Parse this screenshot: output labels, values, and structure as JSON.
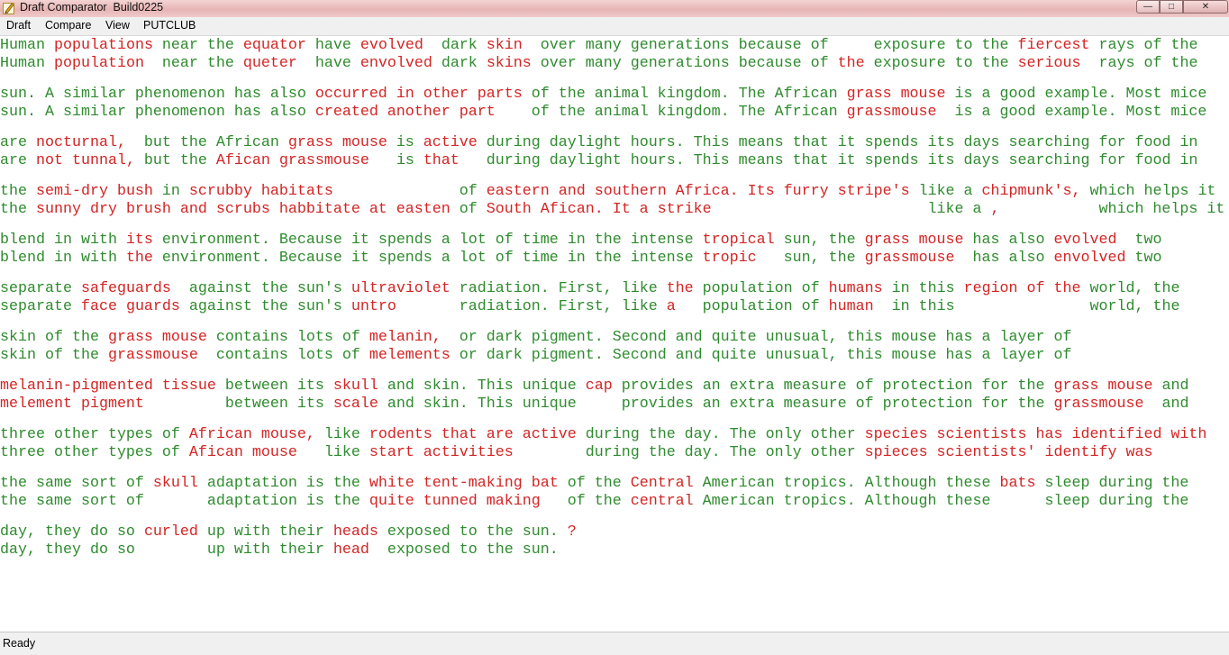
{
  "window": {
    "title": "Draft Comparator  Build0225",
    "minimize_glyph": "—",
    "maximize_glyph": "□",
    "close_glyph": "✕"
  },
  "menu": [
    "Draft",
    "Compare",
    "View",
    "PUTCLUB"
  ],
  "colors": {
    "match": "#2e8b2e",
    "mismatch": "#d42424"
  },
  "status": {
    "text": "Ready"
  },
  "comparison_pairs": [
    {
      "original": [
        [
          "g",
          "Human "
        ],
        [
          "r",
          "populations"
        ],
        [
          "g",
          " near the "
        ],
        [
          "r",
          "equator"
        ],
        [
          "g",
          " have "
        ],
        [
          "r",
          "evolved"
        ],
        [
          "g",
          "  dark "
        ],
        [
          "r",
          "skin"
        ],
        [
          "g",
          "  over many generations because of     exposure to the "
        ],
        [
          "r",
          "fiercest"
        ],
        [
          "g",
          " rays of the"
        ]
      ],
      "draft": [
        [
          "g",
          "Human "
        ],
        [
          "r",
          "population "
        ],
        [
          "g",
          " near the "
        ],
        [
          "r",
          "queter"
        ],
        [
          "g",
          "  have "
        ],
        [
          "r",
          "envolved"
        ],
        [
          "g",
          " dark "
        ],
        [
          "r",
          "skins"
        ],
        [
          "g",
          " over many generations because of "
        ],
        [
          "r",
          "the"
        ],
        [
          "g",
          " exposure to the "
        ],
        [
          "r",
          "serious "
        ],
        [
          "g",
          " rays of the"
        ]
      ]
    },
    {
      "original": [
        [
          "g",
          "sun. A similar phenomenon has also "
        ],
        [
          "r",
          "occurred in other parts"
        ],
        [
          "g",
          " of the animal kingdom. The African "
        ],
        [
          "r",
          "grass mouse"
        ],
        [
          "g",
          " is a good example. Most mice"
        ]
      ],
      "draft": [
        [
          "g",
          "sun. A similar phenomenon has also "
        ],
        [
          "r",
          "created another part   "
        ],
        [
          "g",
          " of the animal kingdom. The African "
        ],
        [
          "r",
          "grassmouse "
        ],
        [
          "g",
          " is a good example. Most mice"
        ]
      ]
    },
    {
      "original": [
        [
          "g",
          "are "
        ],
        [
          "r",
          "nocturnal, "
        ],
        [
          "g",
          " but the African "
        ],
        [
          "r",
          "grass mouse"
        ],
        [
          "g",
          " is "
        ],
        [
          "r",
          "active"
        ],
        [
          "g",
          " during daylight hours. This means that it spends its days searching for food in"
        ]
      ],
      "draft": [
        [
          "g",
          "are "
        ],
        [
          "r",
          "not tunnal,"
        ],
        [
          "g",
          " but the "
        ],
        [
          "r",
          "Afican grassmouse "
        ],
        [
          "g",
          "  is "
        ],
        [
          "r",
          "that  "
        ],
        [
          "g",
          " during daylight hours. This means that it spends its days searching for food in"
        ]
      ]
    },
    {
      "original": [
        [
          "g",
          "the "
        ],
        [
          "r",
          "semi-dry bush"
        ],
        [
          "g",
          " in "
        ],
        [
          "r",
          "scrubby habitats             "
        ],
        [
          "g",
          " of "
        ],
        [
          "r",
          "eastern and southern Africa. Its furry stripe's"
        ],
        [
          "g",
          " like a "
        ],
        [
          "r",
          "chipmunk's,"
        ],
        [
          "g",
          " which helps it"
        ]
      ],
      "draft": [
        [
          "g",
          "the "
        ],
        [
          "r",
          "sunny dry brush and scrubs habbitate at easten"
        ],
        [
          "g",
          " of "
        ],
        [
          "r",
          "South Afican. It a strike                       "
        ],
        [
          "g",
          " like a "
        ],
        [
          "r",
          ",          "
        ],
        [
          "g",
          " which helps it"
        ]
      ]
    },
    {
      "original": [
        [
          "g",
          "blend in with "
        ],
        [
          "r",
          "its"
        ],
        [
          "g",
          " environment. Because it spends a lot of time in the intense "
        ],
        [
          "r",
          "tropical"
        ],
        [
          "g",
          " sun, the "
        ],
        [
          "r",
          "grass mouse"
        ],
        [
          "g",
          " has also "
        ],
        [
          "r",
          "evolved "
        ],
        [
          "g",
          " two"
        ]
      ],
      "draft": [
        [
          "g",
          "blend in with "
        ],
        [
          "r",
          "the"
        ],
        [
          "g",
          " environment. Because it spends a lot of time in the intense "
        ],
        [
          "r",
          "tropic  "
        ],
        [
          "g",
          " sun, the "
        ],
        [
          "r",
          "grassmouse "
        ],
        [
          "g",
          " has also "
        ],
        [
          "r",
          "envolved"
        ],
        [
          "g",
          " two"
        ]
      ]
    },
    {
      "original": [
        [
          "g",
          "separate "
        ],
        [
          "r",
          "safeguards "
        ],
        [
          "g",
          " against the sun's "
        ],
        [
          "r",
          "ultraviolet"
        ],
        [
          "g",
          " radiation. First, like "
        ],
        [
          "r",
          "the"
        ],
        [
          "g",
          " population of "
        ],
        [
          "r",
          "humans"
        ],
        [
          "g",
          " in this "
        ],
        [
          "r",
          "region of the"
        ],
        [
          "g",
          " world, the"
        ]
      ],
      "draft": [
        [
          "g",
          "separate "
        ],
        [
          "r",
          "face guards"
        ],
        [
          "g",
          " against the sun's "
        ],
        [
          "r",
          "untro      "
        ],
        [
          "g",
          " radiation. First, like "
        ],
        [
          "r",
          "a  "
        ],
        [
          "g",
          " population of "
        ],
        [
          "r",
          "human "
        ],
        [
          "g",
          " in this "
        ],
        [
          "r",
          "             "
        ],
        [
          "g",
          " world, the"
        ]
      ]
    },
    {
      "original": [
        [
          "g",
          "skin of the "
        ],
        [
          "r",
          "grass mouse"
        ],
        [
          "g",
          " contains lots of "
        ],
        [
          "r",
          "melanin, "
        ],
        [
          "g",
          " or dark pigment. Second and quite unusual, this mouse has a layer of"
        ]
      ],
      "draft": [
        [
          "g",
          "skin of the "
        ],
        [
          "r",
          "grassmouse "
        ],
        [
          "g",
          " contains lots of "
        ],
        [
          "r",
          "melements"
        ],
        [
          "g",
          " or dark pigment. Second and quite unusual, this mouse has a layer of"
        ]
      ]
    },
    {
      "original": [
        [
          "r",
          "melanin-pigmented tissue"
        ],
        [
          "g",
          " between its "
        ],
        [
          "r",
          "skull"
        ],
        [
          "g",
          " and skin. This unique "
        ],
        [
          "r",
          "cap"
        ],
        [
          "g",
          " provides an extra measure of protection for the "
        ],
        [
          "r",
          "grass mouse"
        ],
        [
          "g",
          " and"
        ]
      ],
      "draft": [
        [
          "r",
          "melement pigment        "
        ],
        [
          "g",
          " between its "
        ],
        [
          "r",
          "scale"
        ],
        [
          "g",
          " and skin. This unique "
        ],
        [
          "r",
          "   "
        ],
        [
          "g",
          " provides an extra measure of protection for the "
        ],
        [
          "r",
          "grassmouse "
        ],
        [
          "g",
          " and"
        ]
      ]
    },
    {
      "original": [
        [
          "g",
          "three other types of "
        ],
        [
          "r",
          "African mouse,"
        ],
        [
          "g",
          " like "
        ],
        [
          "r",
          "rodents that are active"
        ],
        [
          "g",
          " during the day. The only other "
        ],
        [
          "r",
          "species scientists has identified with"
        ]
      ],
      "draft": [
        [
          "g",
          "three other types of "
        ],
        [
          "r",
          "Afican mouse  "
        ],
        [
          "g",
          " like "
        ],
        [
          "r",
          "start activities       "
        ],
        [
          "g",
          " during the day. The only other "
        ],
        [
          "r",
          "spieces scientists' identify was"
        ]
      ]
    },
    {
      "original": [
        [
          "g",
          "the same sort of "
        ],
        [
          "r",
          "skull"
        ],
        [
          "g",
          " adaptation is the "
        ],
        [
          "r",
          "white tent-making bat"
        ],
        [
          "g",
          " of the "
        ],
        [
          "r",
          "Central"
        ],
        [
          "g",
          " American tropics. Although these "
        ],
        [
          "r",
          "bats"
        ],
        [
          "g",
          " sleep during the"
        ]
      ],
      "draft": [
        [
          "g",
          "the same sort of "
        ],
        [
          "r",
          "     "
        ],
        [
          "g",
          " adaptation is the "
        ],
        [
          "r",
          "quite tunned making  "
        ],
        [
          "g",
          " of the "
        ],
        [
          "r",
          "central"
        ],
        [
          "g",
          " American tropics. Although these "
        ],
        [
          "r",
          "    "
        ],
        [
          "g",
          " sleep during the"
        ]
      ]
    },
    {
      "original": [
        [
          "g",
          "day, they do so "
        ],
        [
          "r",
          "curled"
        ],
        [
          "g",
          " up with their "
        ],
        [
          "r",
          "heads"
        ],
        [
          "g",
          " exposed to the sun. "
        ],
        [
          "r",
          "?"
        ]
      ],
      "draft": [
        [
          "g",
          "day, they do so "
        ],
        [
          "r",
          "      "
        ],
        [
          "g",
          " up with their "
        ],
        [
          "r",
          "head "
        ],
        [
          "g",
          " exposed to the sun."
        ]
      ]
    }
  ]
}
